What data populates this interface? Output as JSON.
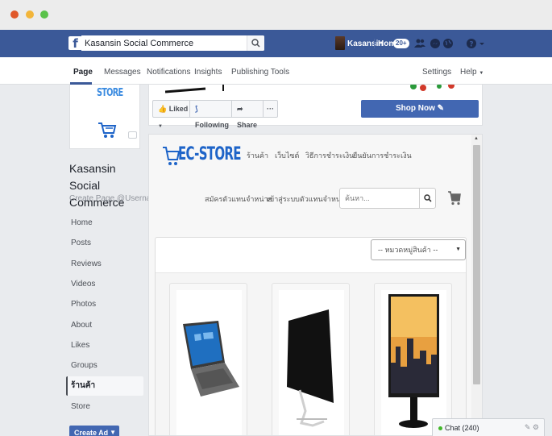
{
  "window": {
    "dots": [
      "close",
      "minimize",
      "maximize"
    ]
  },
  "topbar": {
    "search_value": "Kasansin Social Commerce",
    "profile_name": "Kasansin",
    "home_label": "Home",
    "home_badge": "20+"
  },
  "page_nav": {
    "items": [
      "Page",
      "Messages",
      "Notifications",
      "Insights",
      "Publishing Tools"
    ],
    "settings": "Settings",
    "help": "Help"
  },
  "sidebar": {
    "page_name": "Kasansin Social Commerce",
    "username": "Create Page @Username",
    "profile_logo_text": "STORE",
    "items": [
      "Home",
      "Posts",
      "Reviews",
      "Videos",
      "Photos",
      "About",
      "Likes",
      "Groups",
      "ร้านค้า",
      "Store"
    ],
    "active_index": 8,
    "create_ad": "Create Ad"
  },
  "cover": {
    "liked": "Liked",
    "following": "Following",
    "share": "Share",
    "more": "···",
    "shop_now": "Shop Now"
  },
  "store": {
    "logo": "EC-STORE",
    "nav": [
      "ร้านค้า",
      "เว็บไซต์",
      "วิธีการชำระเงิน",
      "ยืนยันการชำระเงิน"
    ],
    "nav2": [
      "สมัครตัวแทนจำหน่าย",
      "เข้าสู่ระบบตัวแทนจำหน่าย"
    ],
    "search_placeholder": "ค้นหา...",
    "category_select": "-- หมวดหมู่สินค้า --",
    "products": [
      "laptop",
      "monitor",
      "tv-stand"
    ]
  },
  "chat": {
    "label": "Chat (240)"
  },
  "colors": {
    "facebook_blue": "#3b5998",
    "button_blue": "#4267b2",
    "store_blue": "#1e64c8"
  }
}
